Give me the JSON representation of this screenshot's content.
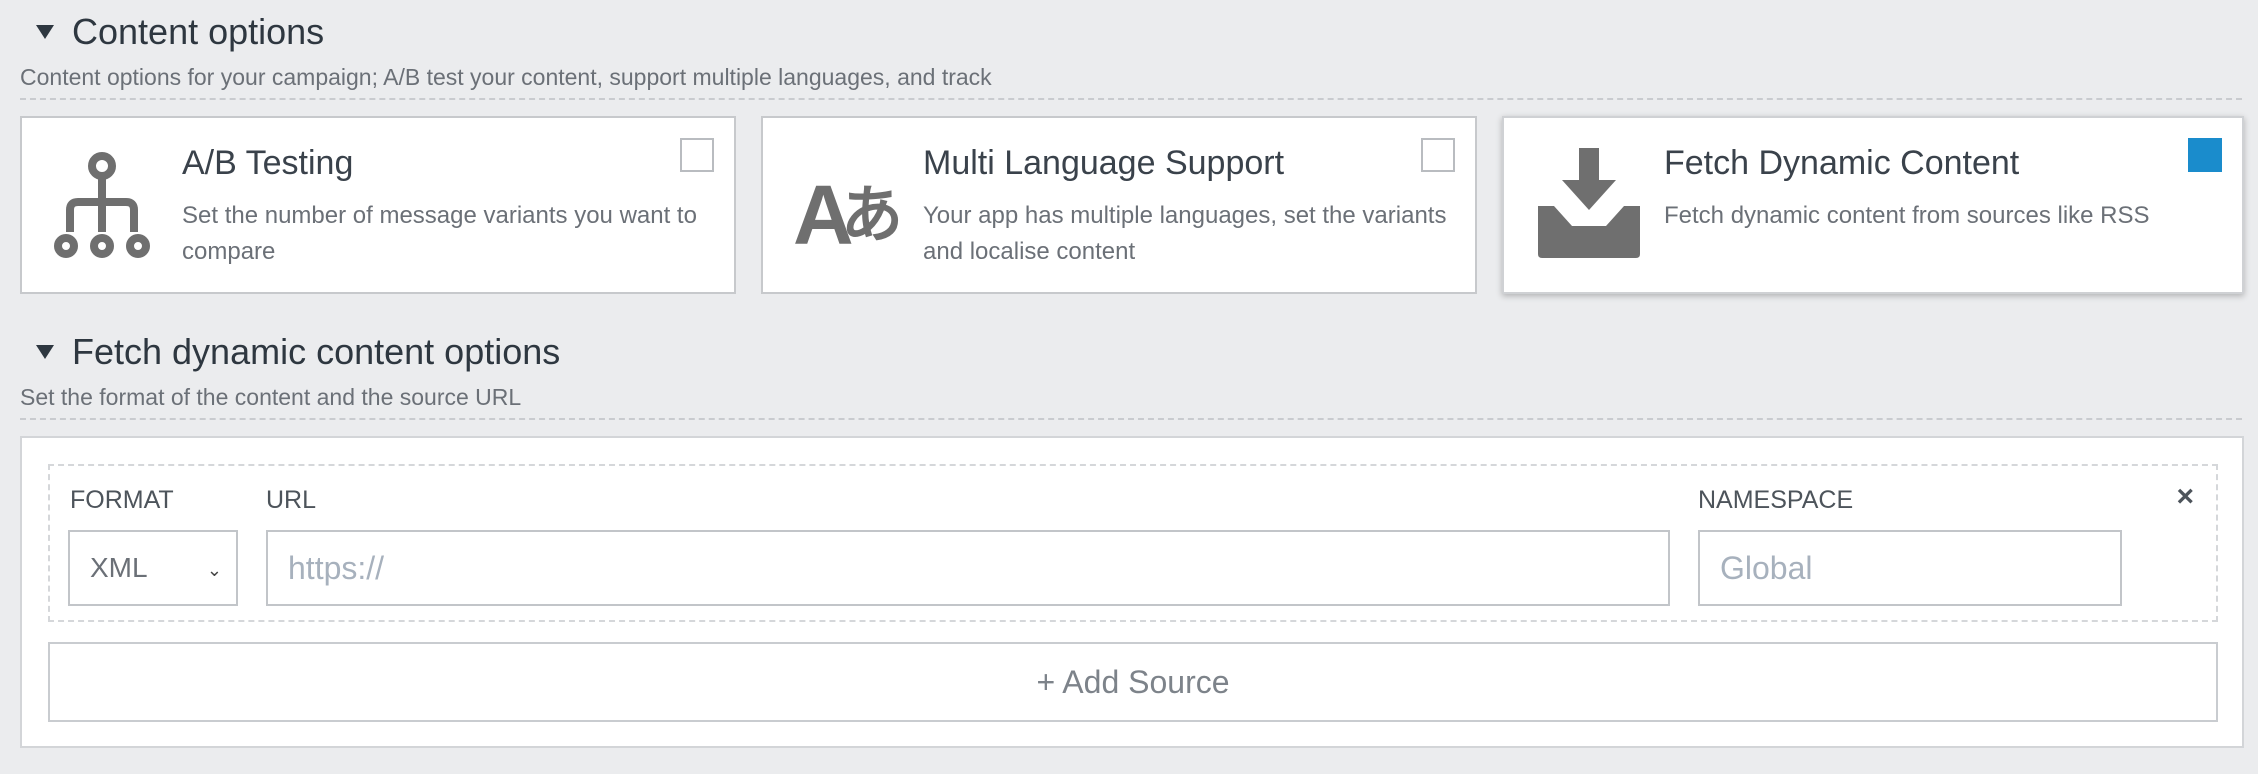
{
  "content_options": {
    "title": "Content options",
    "description": "Content options for your campaign; A/B test your content, support multiple languages, and track"
  },
  "cards": [
    {
      "icon": "ab-testing-icon",
      "title": "A/B Testing",
      "description": "Set the number of message variants you want to compare",
      "checked": false
    },
    {
      "icon": "language-icon",
      "title": "Multi Language Support",
      "description": "Your app has multiple languages, set the variants and localise content",
      "checked": false
    },
    {
      "icon": "inbox-download-icon",
      "title": "Fetch Dynamic Content",
      "description": "Fetch dynamic content from sources like RSS",
      "checked": true
    }
  ],
  "fetch_options": {
    "title": "Fetch dynamic content options",
    "description": "Set the format of the content and the source URL"
  },
  "source_row": {
    "format_label": "FORMAT",
    "format_value": "XML",
    "url_label": "URL",
    "url_placeholder": "https://",
    "namespace_label": "NAMESPACE",
    "namespace_placeholder": "Global",
    "remove_symbol": "×"
  },
  "add_source_label": "+ Add Source",
  "colors": {
    "accent": "#1a8ccc",
    "icon": "#6f6f6f"
  },
  "language_icon_text": {
    "latin": "A",
    "kana": "あ"
  }
}
